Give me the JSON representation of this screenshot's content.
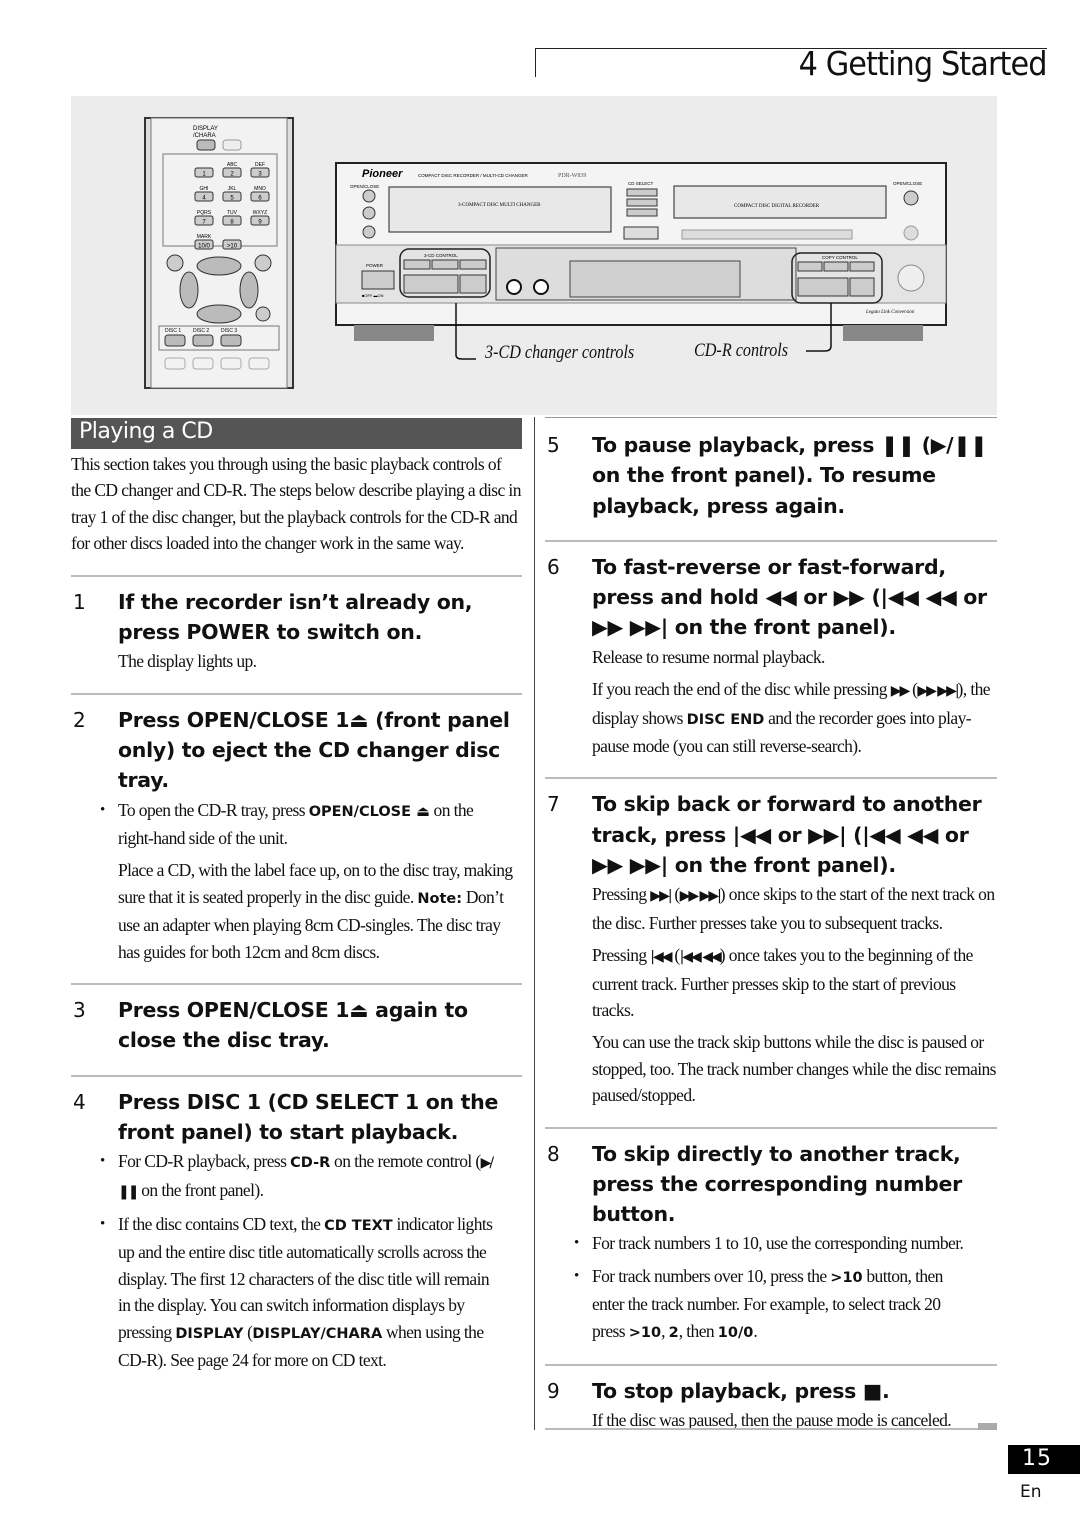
{
  "header": {
    "title": "4 Getting Started"
  },
  "illustration": {
    "remote_labels": {
      "display": "DISPLAY",
      "chara": "/CHARA",
      "abc": "ABC",
      "def": "DEF",
      "ghi": "GHI",
      "jkl": "JKL",
      "mno": "MNO",
      "pqrs": "PQRS",
      "tuv": "TUV",
      "wxyz": "WXYZ",
      "mark": "MARK",
      "keys": [
        "1",
        "2",
        "3",
        "4",
        "5",
        "6",
        "7",
        "8",
        "9",
        "10/0",
        ">10"
      ],
      "disc1": "DISC 1",
      "disc2": "DISC 2",
      "disc3": "DISC 3"
    },
    "unit_labels": {
      "brand": "Pioneer",
      "model_desc": "COMPACT DISC RECORDER / MULTI-CD CHANGER",
      "model": "PDR-W839",
      "open_close": "OPEN/CLOSE",
      "changer": "3-COMPACT DISC MULTI CHANGER",
      "cd_select": "CD SELECT",
      "recorder": "COMPACT DISC DIGITAL RECORDER",
      "cd_control": "3-CD CONTROL",
      "copy_control": "COPY CONTROL",
      "power": "POWER",
      "power_state": "■OFF ▬ON",
      "display_btn": "DISPLAY",
      "character": "CHARACTER",
      "legato": "Legato Link Conversion"
    },
    "callout_changer": "3-CD changer controls",
    "callout_cdr": "CD-R controls"
  },
  "left": {
    "section_title": "Playing a CD",
    "intro": "This section takes you through using the basic playback controls of the CD changer and CD-R. The steps below describe playing a disc in tray 1 of the disc changer, but the playback controls for the CD-R and for other discs loaded into the changer work in the same way.",
    "steps": [
      {
        "num": "1",
        "title": "If the recorder isn’t already on, press POWER to switch on.",
        "paras": [
          {
            "bullet": false,
            "segs": [
              {
                "t": "The display lights up."
              }
            ]
          }
        ]
      },
      {
        "num": "2",
        "title": "Press OPEN/CLOSE 1⏏ (front panel only) to eject the CD changer disc tray.",
        "paras": [
          {
            "bullet": true,
            "segs": [
              {
                "t": "To open the CD-R tray, press "
              },
              {
                "t": "OPEN/CLOSE ⏏",
                "b": true
              },
              {
                "t": " on the right-hand side of the unit."
              }
            ]
          },
          {
            "bullet": false,
            "segs": [
              {
                "t": "Place a CD, with the label face up, on to the disc tray, making sure that it is seated properly in the disc guide. "
              },
              {
                "t": "Note:",
                "b": true
              },
              {
                "t": " Don’t use an adapter when playing 8cm CD-singles. The disc tray has guides for both 12cm and 8cm discs."
              }
            ]
          }
        ]
      },
      {
        "num": "3",
        "title": "Press OPEN/CLOSE 1⏏ again to close the disc tray.",
        "paras": []
      },
      {
        "num": "4",
        "title": "Press DISC 1 (CD SELECT 1 on the front panel) to start playback.",
        "paras": [
          {
            "bullet": true,
            "segs": [
              {
                "t": "For CD-R playback, press "
              },
              {
                "t": "CD-R",
                "b": true
              },
              {
                "t": " on the remote control ("
              },
              {
                "t": "▶/❚❚",
                "g": true
              },
              {
                "t": " on the front panel)."
              }
            ]
          },
          {
            "bullet": true,
            "segs": [
              {
                "t": "If the disc contains CD text, the "
              },
              {
                "t": "CD TEXT",
                "b": true
              },
              {
                "t": " indicator lights up and the entire disc title automatically scrolls across the display. The first 12 characters of the disc title will remain in the display. You can switch information displays by pressing "
              },
              {
                "t": "DISPLAY",
                "b": true
              },
              {
                "t": " ("
              },
              {
                "t": "DISPLAY/CHARA",
                "b": true
              },
              {
                "t": " when using the CD-R). See page 24 for more on CD text."
              }
            ]
          }
        ]
      }
    ]
  },
  "right": {
    "steps": [
      {
        "num": "5",
        "title": "To pause playback, press ❚❚ (▶/❚❚ on the front panel). To resume playback, press again.",
        "paras": []
      },
      {
        "num": "6",
        "title": "To fast-reverse or fast-forward, press and hold ◀◀ or ▶▶ (|◀◀ ◀◀ or ▶▶ ▶▶| on the front panel).",
        "paras": [
          {
            "bullet": false,
            "segs": [
              {
                "t": "Release to resume normal playback."
              }
            ]
          },
          {
            "bullet": false,
            "segs": [
              {
                "t": "If you reach the end of the disc while pressing "
              },
              {
                "t": "▶▶",
                "g": true
              },
              {
                "t": " ("
              },
              {
                "t": "▶▶ ▶▶|",
                "g": true
              },
              {
                "t": "), the display shows "
              },
              {
                "t": "DISC END",
                "b": true
              },
              {
                "t": " and the recorder goes into play-pause mode (you can still reverse-search)."
              }
            ]
          }
        ]
      },
      {
        "num": "7",
        "title": "To skip back or forward to another track, press |◀◀ or ▶▶| (|◀◀ ◀◀ or ▶▶ ▶▶| on the front panel).",
        "paras": [
          {
            "bullet": false,
            "segs": [
              {
                "t": "Pressing "
              },
              {
                "t": "▶▶|",
                "g": true
              },
              {
                "t": " ("
              },
              {
                "t": "▶▶ ▶▶|",
                "g": true
              },
              {
                "t": ") once skips to the start of the next track on the disc. Further presses take you to subsequent tracks."
              }
            ]
          },
          {
            "bullet": false,
            "segs": [
              {
                "t": "Pressing "
              },
              {
                "t": "|◀◀",
                "g": true
              },
              {
                "t": " ("
              },
              {
                "t": "|◀◀ ◀◀",
                "g": true
              },
              {
                "t": ") once takes you to the beginning of the current track. Further presses skip to the start of previous tracks."
              }
            ]
          },
          {
            "bullet": false,
            "segs": [
              {
                "t": "You can use the track skip buttons while the disc is paused or stopped, too. The track number changes while the disc remains paused/stopped."
              }
            ]
          }
        ]
      },
      {
        "num": "8",
        "title": "To skip directly to another track, press the corresponding number button.",
        "paras": [
          {
            "bullet": true,
            "segs": [
              {
                "t": "For track numbers 1 to 10, use the corresponding number."
              }
            ]
          },
          {
            "bullet": true,
            "segs": [
              {
                "t": "For track numbers over 10, press the "
              },
              {
                "t": ">10",
                "b": true
              },
              {
                "t": " button, then enter the track number. For example, to select track 20 press "
              },
              {
                "t": ">10",
                "b": true
              },
              {
                "t": ", "
              },
              {
                "t": "2",
                "b": true
              },
              {
                "t": ", then "
              },
              {
                "t": "10/0",
                "b": true
              },
              {
                "t": "."
              }
            ]
          }
        ]
      },
      {
        "num": "9",
        "title": "To stop playback, press ■.",
        "paras": [
          {
            "bullet": false,
            "segs": [
              {
                "t": "If the disc was paused, then the pause mode is canceled."
              }
            ]
          }
        ]
      }
    ]
  },
  "footer": {
    "page_number": "15",
    "language": "En"
  }
}
